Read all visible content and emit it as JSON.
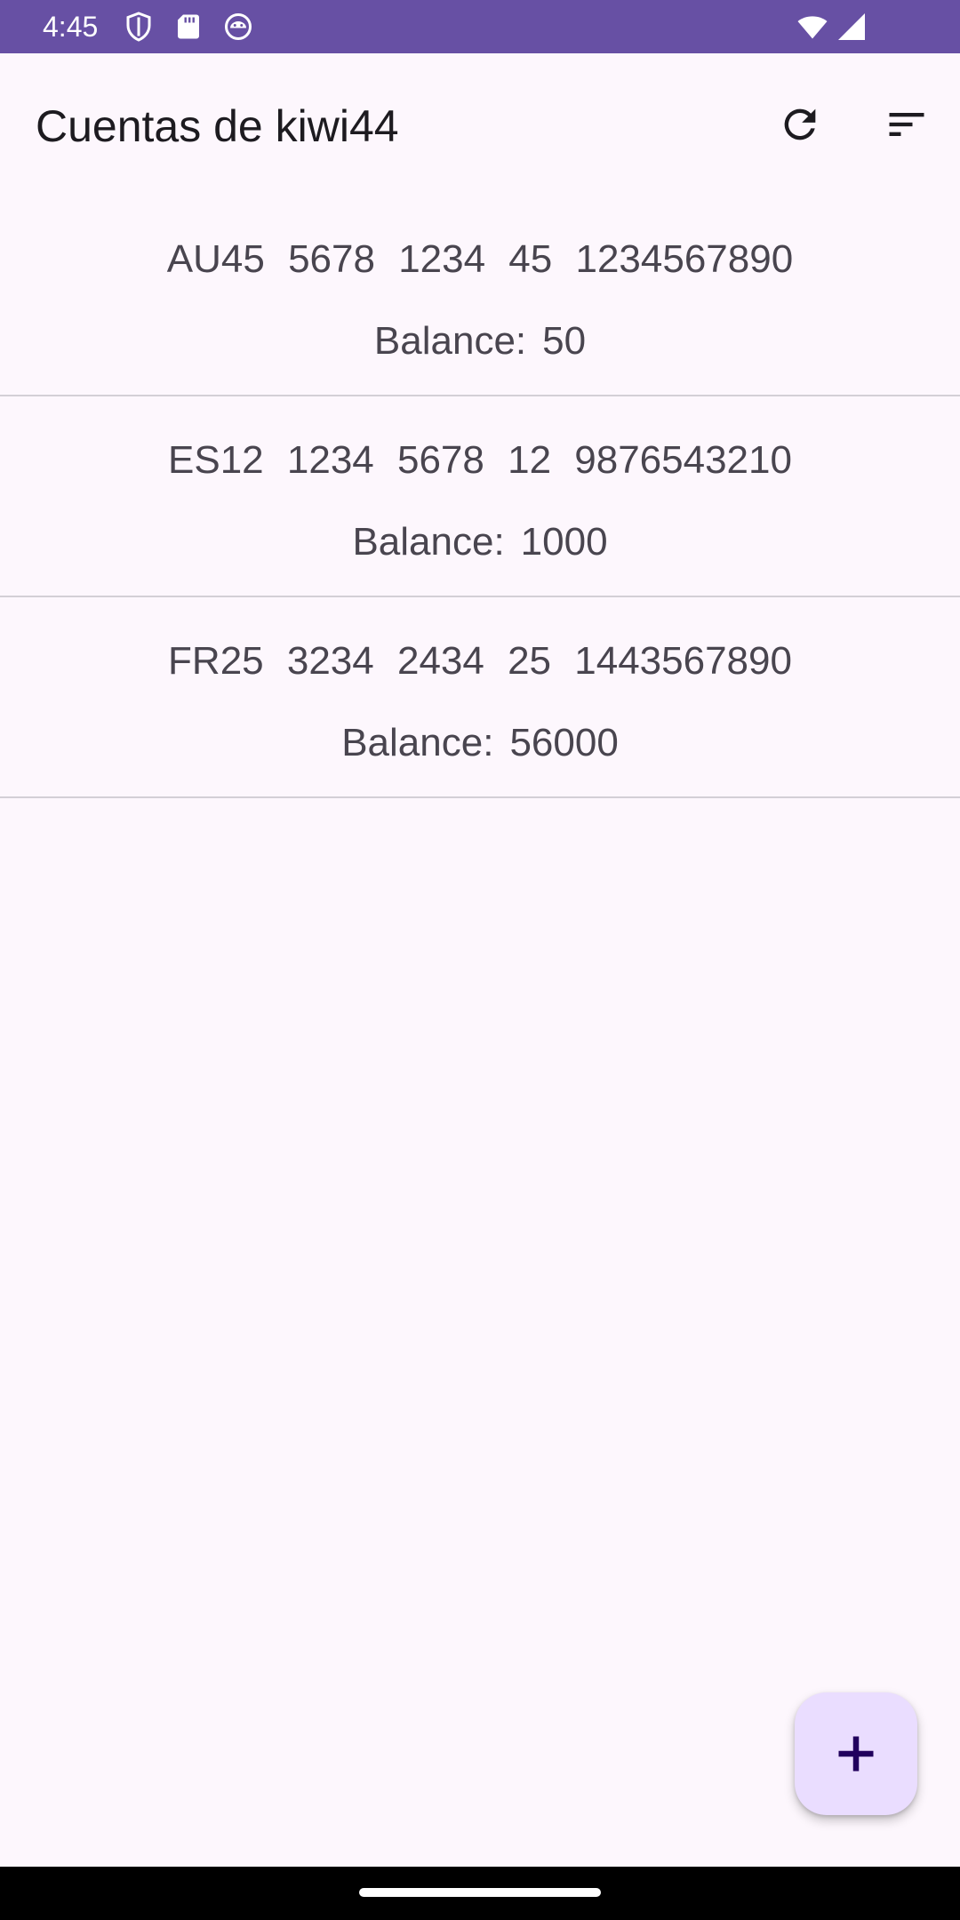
{
  "status_bar": {
    "time": "4:45",
    "left_icons": [
      "shield-icon",
      "sd-card-icon",
      "android-face-icon"
    ],
    "right_icons": [
      "wifi-icon",
      "cell-signal-icon"
    ],
    "background": "#6750a4"
  },
  "app_bar": {
    "title": "Cuentas de kiwi44",
    "actions": [
      {
        "name": "refresh-icon",
        "label": "refresh"
      },
      {
        "name": "sort-icon",
        "label": "sort"
      }
    ]
  },
  "accounts": [
    {
      "iban": "AU45 5678 1234 45 1234567890",
      "balance_label": "Balance:",
      "balance_value": "50"
    },
    {
      "iban": "ES12 1234 5678 12 9876543210",
      "balance_label": "Balance:",
      "balance_value": "1000"
    },
    {
      "iban": "FR25 3234 2434 25 1443567890",
      "balance_label": "Balance:",
      "balance_value": "56000"
    }
  ],
  "fab": {
    "icon": "plus-icon",
    "background": "#eaddff",
    "icon_color": "#21005d"
  },
  "colors": {
    "background": "#fdf7fd",
    "divider": "#d3cfd6",
    "text_primary": "#1d1b20",
    "text_secondary": "#49454f"
  }
}
